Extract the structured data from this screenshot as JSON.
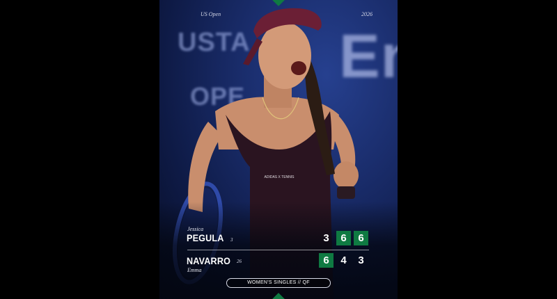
{
  "header": {
    "event": "US Open",
    "year": "2026"
  },
  "banner_text": {
    "left_top": "USTA",
    "left_bottom": "OPE",
    "right": "En"
  },
  "shirt_text": "ADIDAS X TENNIS",
  "players": [
    {
      "first": "Jessica",
      "last": "PEGULA",
      "seed": "3",
      "sets": [
        "3",
        "6",
        "6"
      ],
      "set_won": [
        false,
        true,
        true
      ]
    },
    {
      "first": "Emma",
      "last": "NAVARRO",
      "seed": "26",
      "sets": [
        "6",
        "4",
        "3"
      ],
      "set_won": [
        true,
        false,
        false
      ]
    }
  ],
  "round_label": "WOMEN'S SINGLES // QF",
  "colors": {
    "win": "#0f7a42",
    "background": "#1a2d6c",
    "page": "#000000"
  }
}
